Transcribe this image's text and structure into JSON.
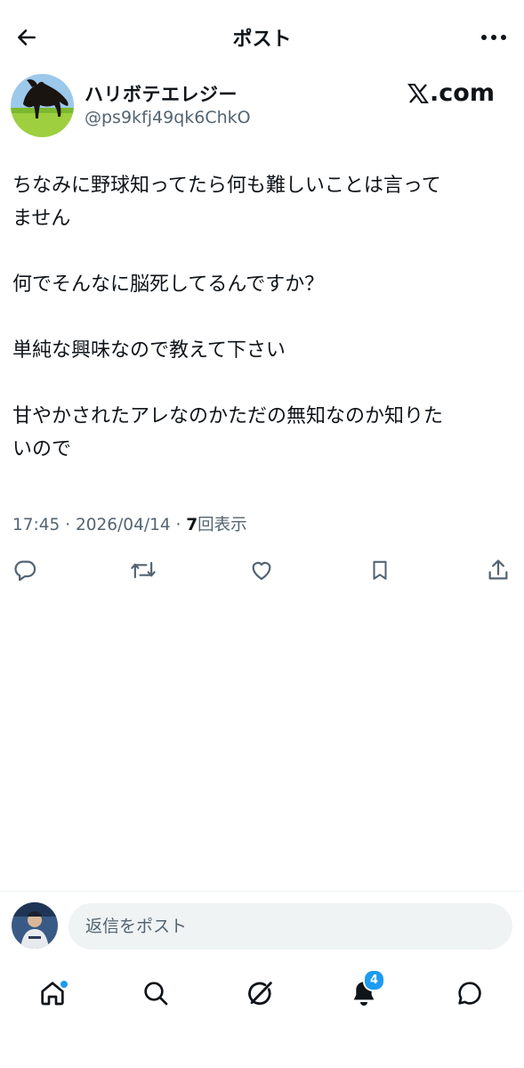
{
  "header": {
    "title": "ポスト",
    "back_icon": "arrow-left-icon",
    "more_icon": "more-horizontal-icon"
  },
  "author": {
    "display_name": "ハリボテエレジー",
    "handle": "@ps9kfj49qk6ChkO",
    "avatar": "horse-avatar"
  },
  "watermark": {
    "text": ".com",
    "logo_icon": "x-logo-icon"
  },
  "post": {
    "lines": [
      "ちなみに野球知ってたら何も難しいことは言って",
      "ません",
      "",
      "何でそんなに脳死してるんですか？",
      "",
      "単純な興味なので教えて下さい",
      "",
      "甘やかされたアレなのかただの無知なのか知りた",
      "いので"
    ],
    "time": "17:45",
    "separator": " · ",
    "date": "2026/04/14",
    "views_count": "7",
    "views_label": "回表示"
  },
  "actions": [
    {
      "name": "reply-icon"
    },
    {
      "name": "repost-icon"
    },
    {
      "name": "like-icon"
    },
    {
      "name": "bookmark-icon"
    },
    {
      "name": "share-icon"
    }
  ],
  "reply_bar": {
    "placeholder": "返信をポスト",
    "avatar": "baseball-player-avatar"
  },
  "tabbar": {
    "items": [
      "home-icon",
      "search-icon",
      "grok-icon",
      "notifications-icon",
      "messages-icon"
    ],
    "notifications_badge": "4"
  },
  "colors": {
    "text": "#0f1419",
    "secondary": "#536471",
    "accent": "#1d9bf0",
    "input_bg": "#eff3f4"
  }
}
